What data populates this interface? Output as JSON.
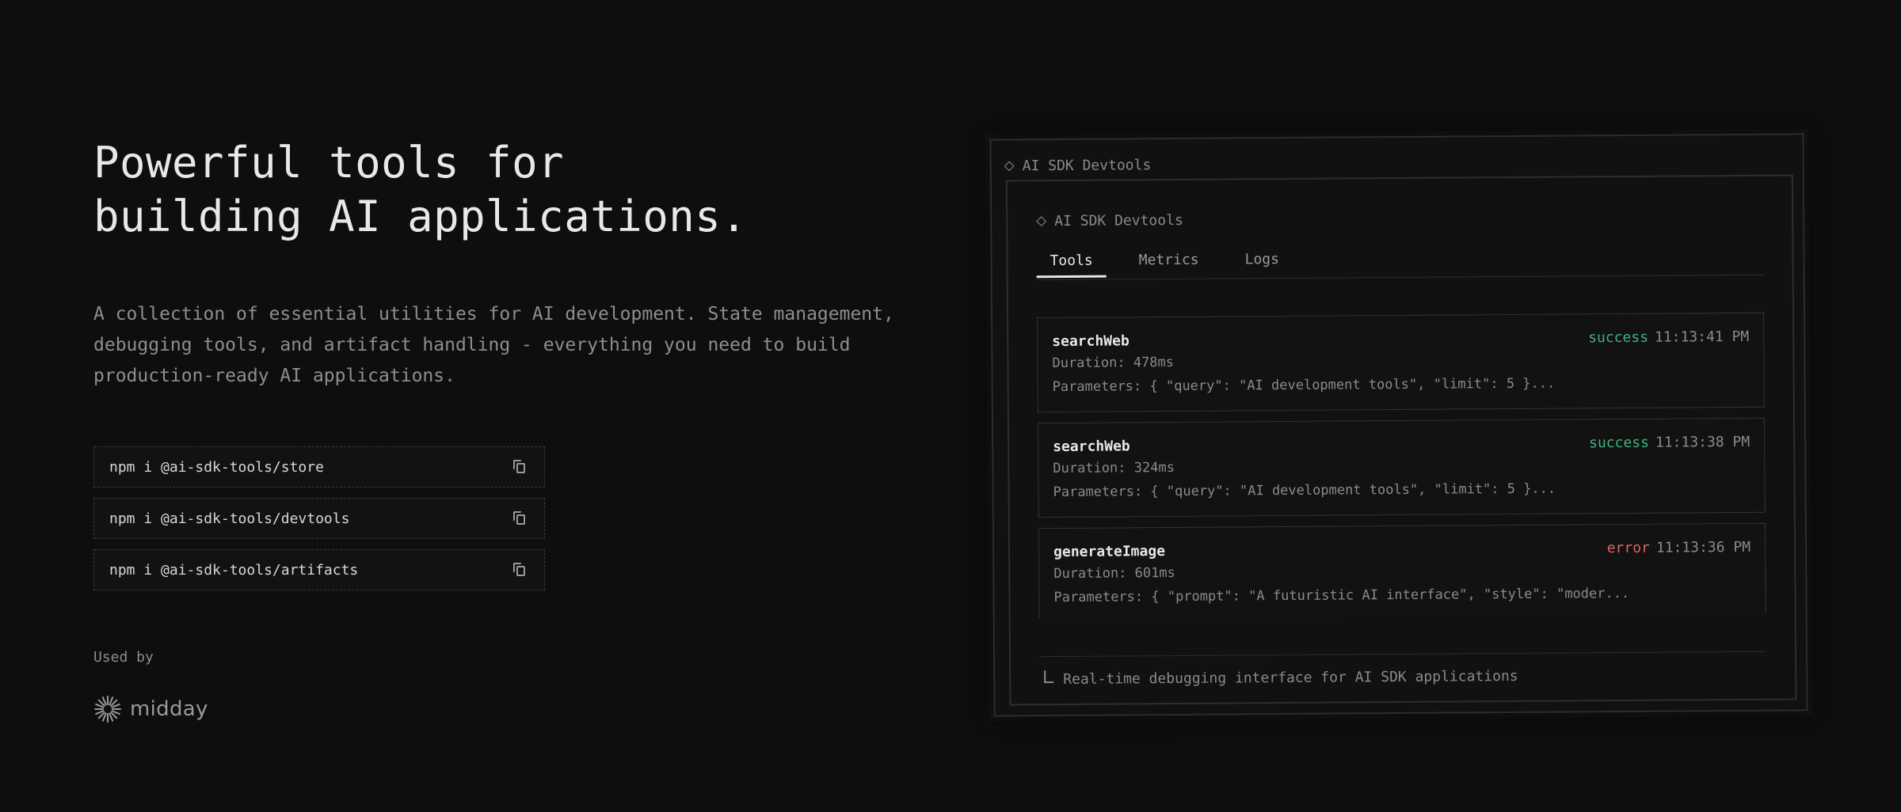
{
  "hero": {
    "line1": "Powerful tools for",
    "line2": "building AI applications."
  },
  "description": "A collection of essential utilities for AI development. State management, debugging tools, and artifact handling - everything you need to build production-ready AI applications.",
  "installs": [
    {
      "command": "npm i @ai-sdk-tools/store",
      "icon": "copy-icon"
    },
    {
      "command": "npm i @ai-sdk-tools/devtools",
      "icon": "copy-icon"
    },
    {
      "command": "npm i @ai-sdk-tools/artifacts",
      "icon": "copy-icon"
    }
  ],
  "used_by": {
    "label": "Used by",
    "brand": "midday",
    "brand_icon": "sunburst-logo-icon"
  },
  "devtools": {
    "window_title": "AI SDK Devtools",
    "panel_title": "AI SDK Devtools",
    "tabs": [
      "Tools",
      "Metrics",
      "Logs"
    ],
    "active_tab": "Tools",
    "calls": [
      {
        "name": "searchWeb",
        "status": "success",
        "time": "11:13:41 PM",
        "duration": "Duration: 478ms",
        "params": "Parameters: { \"query\": \"AI development tools\", \"limit\": 5 }..."
      },
      {
        "name": "searchWeb",
        "status": "success",
        "time": "11:13:38 PM",
        "duration": "Duration: 324ms",
        "params": "Parameters: { \"query\": \"AI development tools\", \"limit\": 5 }..."
      },
      {
        "name": "generateImage",
        "status": "error",
        "time": "11:13:36 PM",
        "duration": "Duration: 601ms",
        "params": "Parameters: { \"prompt\": \"A futuristic AI interface\", \"style\": \"moder..."
      }
    ],
    "footer_note": "Real-time debugging interface for AI SDK applications",
    "colors": {
      "success": "#3fb37f",
      "error": "#e06363"
    }
  }
}
